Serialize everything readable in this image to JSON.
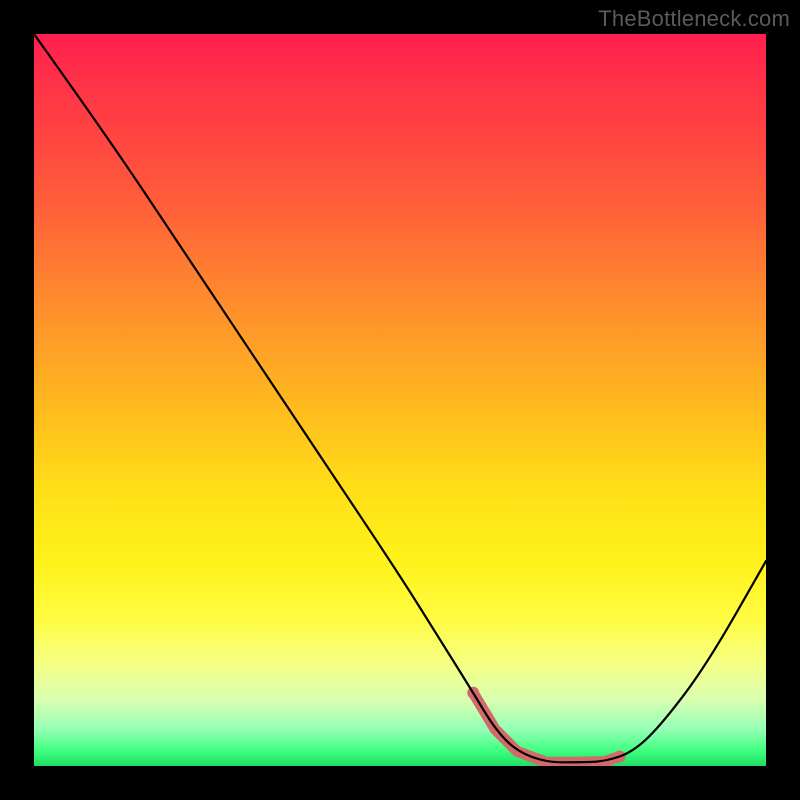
{
  "watermark": "TheBottleneck.com",
  "colors": {
    "frame_bg": "#000000",
    "curve": "#000000",
    "highlight": "#d26a6a",
    "gradient_top": "#ff1f4e",
    "gradient_bottom": "#1dde62"
  },
  "chart_data": {
    "type": "line",
    "title": "",
    "xlabel": "",
    "ylabel": "",
    "xlim": [
      0,
      100
    ],
    "ylim": [
      0,
      100
    ],
    "grid": false,
    "series": [
      {
        "name": "bottleneck_curve",
        "x": [
          0,
          10,
          20,
          30,
          40,
          50,
          55,
          60,
          63,
          66,
          70,
          74,
          78,
          82,
          86,
          92,
          100
        ],
        "y": [
          100,
          86,
          71,
          56,
          41,
          26,
          18,
          10,
          5,
          2,
          0.5,
          0.5,
          0.6,
          2,
          6,
          14,
          28
        ]
      }
    ],
    "highlight_range_x": [
      60,
      80
    ],
    "annotations": []
  }
}
